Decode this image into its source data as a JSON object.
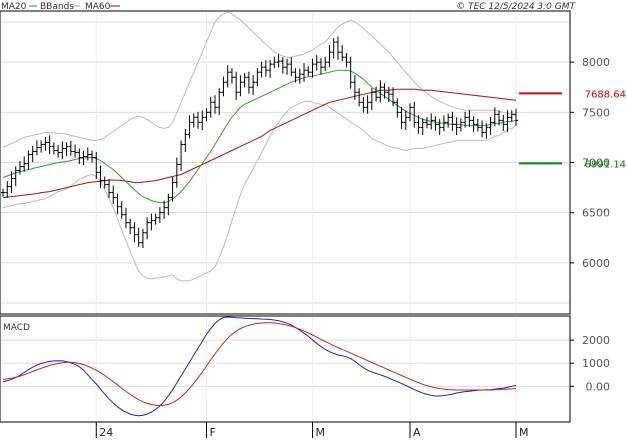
{
  "header": {
    "legend": [
      {
        "name": "MA20",
        "color": "#22aa22"
      },
      {
        "name": "BBands",
        "color": "#aaaaaa"
      },
      {
        "name": "MA60",
        "color": "#aa1111"
      }
    ],
    "copyright": "© TEC 12/5/2024 3:0 GMT"
  },
  "chart_data": [
    {
      "type": "line",
      "title": "",
      "subtype": "ohlc-bars",
      "y_axis_position": "right",
      "ylim": [
        5500,
        8500
      ],
      "yticks": [
        6000,
        6500,
        7000,
        7500,
        8000
      ],
      "ytick_labels": [
        "6000",
        "6500",
        "7000",
        "7500",
        "8000"
      ],
      "grid": true,
      "x_labels": [
        {
          "label": "24",
          "index": 22
        },
        {
          "label": "F",
          "index": 48
        },
        {
          "label": "M",
          "index": 73
        },
        {
          "label": "A",
          "index": 96
        },
        {
          "label": "M",
          "index": 121
        }
      ],
      "levels": [
        {
          "label": "7688.64",
          "value": 7688.64,
          "color": "#dd0000"
        },
        {
          "label": "6991.14",
          "value": 6991.14,
          "color": "#008800"
        }
      ],
      "close": [
        6700,
        6760,
        6840,
        6920,
        6960,
        6990,
        7080,
        7110,
        7150,
        7180,
        7200,
        7160,
        7120,
        7100,
        7140,
        7160,
        7110,
        7100,
        7050,
        7060,
        7080,
        7050,
        6900,
        6820,
        6780,
        6700,
        6650,
        6560,
        6480,
        6400,
        6350,
        6280,
        6200,
        6300,
        6400,
        6420,
        6450,
        6500,
        6550,
        6650,
        6800,
        6980,
        7180,
        7280,
        7400,
        7450,
        7400,
        7450,
        7500,
        7600,
        7550,
        7700,
        7800,
        7900,
        7850,
        7700,
        7800,
        7850,
        7750,
        7800,
        7900,
        7950,
        7920,
        7980,
        8000,
        8010,
        7950,
        7980,
        7900,
        7850,
        7880,
        7920,
        7900,
        7980,
        8000,
        7950,
        8000,
        8100,
        8200,
        8100,
        8050,
        8000,
        7800,
        7700,
        7600,
        7550,
        7600,
        7700,
        7650,
        7750,
        7700,
        7680,
        7600,
        7500,
        7400,
        7450,
        7550,
        7400,
        7350,
        7400,
        7380,
        7420,
        7380,
        7350,
        7400,
        7450,
        7380,
        7350,
        7400,
        7450,
        7420,
        7380,
        7350,
        7300,
        7350,
        7400,
        7480,
        7420,
        7380,
        7450,
        7480,
        7420
      ],
      "ma20": [
        6850,
        6865,
        6880,
        6895,
        6910,
        6920,
        6930,
        6940,
        6950,
        6960,
        6970,
        6980,
        6990,
        7000,
        7005,
        7010,
        7020,
        7030,
        7040,
        7045,
        7050,
        7050,
        7040,
        7020,
        6990,
        6960,
        6930,
        6890,
        6850,
        6810,
        6770,
        6730,
        6690,
        6660,
        6640,
        6620,
        6610,
        6600,
        6600,
        6610,
        6640,
        6670,
        6710,
        6760,
        6810,
        6870,
        6930,
        6990,
        7050,
        7110,
        7180,
        7250,
        7320,
        7390,
        7450,
        7500,
        7550,
        7580,
        7600,
        7620,
        7640,
        7660,
        7680,
        7700,
        7720,
        7740,
        7760,
        7780,
        7800,
        7815,
        7830,
        7845,
        7855,
        7860,
        7870,
        7880,
        7890,
        7900,
        7910,
        7920,
        7920,
        7920,
        7910,
        7890,
        7860,
        7830,
        7790,
        7750,
        7720,
        7690,
        7660,
        7630,
        7600,
        7570,
        7540,
        7510,
        7490,
        7470,
        7450,
        7430,
        7420,
        7410,
        7400,
        7395,
        7390,
        7385,
        7380,
        7380,
        7375,
        7370,
        7370,
        7370,
        7370,
        7370,
        7370,
        7380,
        7390,
        7390,
        7400,
        7410,
        7410,
        7420
      ],
      "ma60": [
        6650,
        6655,
        6660,
        6665,
        6670,
        6675,
        6680,
        6685,
        6690,
        6700,
        6705,
        6710,
        6720,
        6730,
        6740,
        6750,
        6760,
        6770,
        6780,
        6790,
        6800,
        6805,
        6810,
        6815,
        6820,
        6825,
        6825,
        6825,
        6820,
        6815,
        6810,
        6800,
        6800,
        6805,
        6810,
        6815,
        6820,
        6830,
        6840,
        6850,
        6860,
        6870,
        6880,
        6900,
        6920,
        6940,
        6960,
        6980,
        7000,
        7020,
        7040,
        7060,
        7080,
        7100,
        7120,
        7140,
        7160,
        7180,
        7200,
        7220,
        7240,
        7260,
        7290,
        7320,
        7340,
        7360,
        7380,
        7400,
        7420,
        7440,
        7460,
        7480,
        7500,
        7520,
        7540,
        7560,
        7580,
        7600,
        7610,
        7620,
        7630,
        7640,
        7650,
        7660,
        7670,
        7680,
        7690,
        7700,
        7710,
        7720,
        7720,
        7720,
        7725,
        7730,
        7730,
        7730,
        7730,
        7730,
        7725,
        7720,
        7720,
        7720,
        7715,
        7710,
        7705,
        7700,
        7695,
        7690,
        7685,
        7680,
        7675,
        7670,
        7665,
        7660,
        7655,
        7650,
        7645,
        7640,
        7635,
        7630,
        7625,
        7620
      ],
      "bb_upper": [
        7150,
        7170,
        7190,
        7210,
        7230,
        7250,
        7260,
        7270,
        7280,
        7290,
        7300,
        7300,
        7295,
        7290,
        7290,
        7280,
        7270,
        7260,
        7250,
        7240,
        7230,
        7220,
        7220,
        7230,
        7250,
        7280,
        7310,
        7340,
        7370,
        7400,
        7430,
        7450,
        7460,
        7450,
        7430,
        7400,
        7370,
        7350,
        7340,
        7350,
        7400,
        7500,
        7600,
        7700,
        7800,
        7900,
        8000,
        8100,
        8200,
        8300,
        8400,
        8450,
        8480,
        8500,
        8480,
        8450,
        8420,
        8380,
        8340,
        8300,
        8260,
        8220,
        8180,
        8140,
        8100,
        8080,
        8060,
        8050,
        8050,
        8060,
        8070,
        8080,
        8100,
        8120,
        8150,
        8180,
        8200,
        8250,
        8300,
        8350,
        8380,
        8400,
        8420,
        8400,
        8370,
        8340,
        8300,
        8260,
        8220,
        8180,
        8140,
        8100,
        8050,
        8000,
        7950,
        7900,
        7850,
        7800,
        7760,
        7720,
        7690,
        7660,
        7630,
        7610,
        7590,
        7570,
        7555,
        7540,
        7530,
        7520,
        7520,
        7520,
        7520,
        7520,
        7520,
        7520,
        7520,
        7510,
        7500,
        7490,
        7480,
        7470
      ],
      "bb_lower": [
        6550,
        6560,
        6570,
        6580,
        6590,
        6590,
        6600,
        6610,
        6620,
        6630,
        6640,
        6660,
        6685,
        6710,
        6720,
        6740,
        6770,
        6800,
        6830,
        6850,
        6870,
        6880,
        6860,
        6810,
        6730,
        6640,
        6550,
        6440,
        6330,
        6220,
        6110,
        6010,
        5920,
        5870,
        5850,
        5840,
        5850,
        5850,
        5860,
        5870,
        5880,
        5840,
        5820,
        5820,
        5820,
        5840,
        5860,
        5880,
        5900,
        5920,
        5960,
        6050,
        6160,
        6280,
        6420,
        6550,
        6680,
        6780,
        6860,
        6940,
        7020,
        7100,
        7180,
        7260,
        7340,
        7400,
        7460,
        7510,
        7550,
        7570,
        7590,
        7610,
        7610,
        7600,
        7590,
        7580,
        7580,
        7550,
        7520,
        7490,
        7460,
        7440,
        7400,
        7380,
        7350,
        7320,
        7280,
        7240,
        7220,
        7200,
        7180,
        7160,
        7150,
        7140,
        7130,
        7120,
        7130,
        7140,
        7140,
        7140,
        7150,
        7160,
        7170,
        7180,
        7190,
        7200,
        7205,
        7220,
        7220,
        7220,
        7220,
        7220,
        7220,
        7220,
        7220,
        7240,
        7260,
        7270,
        7300,
        7330,
        7340,
        7370
      ]
    },
    {
      "type": "line",
      "title": "MACD",
      "y_axis_position": "right",
      "ylim": [
        -1500,
        3000
      ],
      "yticks": [
        0,
        1000,
        2000
      ],
      "ytick_labels": [
        "0.00",
        "1000",
        "2000"
      ],
      "series": [
        {
          "name": "",
          "color": "#2222cc",
          "values": [
            200,
            240,
            300,
            380,
            480,
            600,
            720,
            830,
            920,
            990,
            1040,
            1080,
            1100,
            1110,
            1100,
            1070,
            1020,
            950,
            850,
            700,
            500,
            300,
            100,
            -120,
            -340,
            -540,
            -720,
            -880,
            -1020,
            -1120,
            -1200,
            -1250,
            -1270,
            -1250,
            -1200,
            -1120,
            -1000,
            -850,
            -650,
            -420,
            -150,
            150,
            450,
            750,
            1050,
            1350,
            1650,
            1950,
            2250,
            2500,
            2720,
            2880,
            2980,
            3000,
            2990,
            2970,
            2960,
            2950,
            2940,
            2930,
            2920,
            2910,
            2900,
            2890,
            2870,
            2840,
            2790,
            2730,
            2650,
            2550,
            2430,
            2300,
            2160,
            2010,
            1860,
            1720,
            1600,
            1500,
            1420,
            1360,
            1320,
            1280,
            1200,
            1080,
            940,
            800,
            700,
            620,
            560,
            500,
            430,
            360,
            280,
            200,
            120,
            40,
            -50,
            -140,
            -220,
            -290,
            -350,
            -390,
            -420,
            -420,
            -400,
            -370,
            -330,
            -290,
            -260,
            -230,
            -210,
            -190,
            -170,
            -160,
            -150,
            -140,
            -120,
            -100,
            -80,
            -40,
            0,
            40
          ]
        },
        {
          "name": "",
          "color": "#cc2222",
          "values": [
            300,
            320,
            350,
            390,
            440,
            500,
            570,
            640,
            710,
            780,
            840,
            900,
            950,
            990,
            1020,
            1040,
            1040,
            1020,
            990,
            940,
            870,
            790,
            700,
            590,
            470,
            340,
            200,
            60,
            -80,
            -220,
            -350,
            -470,
            -580,
            -670,
            -740,
            -790,
            -820,
            -830,
            -820,
            -780,
            -710,
            -600,
            -460,
            -290,
            -90,
            130,
            370,
            620,
            880,
            1140,
            1400,
            1650,
            1880,
            2080,
            2250,
            2390,
            2500,
            2580,
            2640,
            2690,
            2720,
            2740,
            2750,
            2750,
            2740,
            2720,
            2690,
            2650,
            2600,
            2540,
            2470,
            2390,
            2310,
            2220,
            2130,
            2030,
            1940,
            1850,
            1760,
            1680,
            1600,
            1520,
            1440,
            1360,
            1280,
            1200,
            1110,
            1030,
            950,
            870,
            790,
            710,
            630,
            550,
            470,
            390,
            310,
            230,
            160,
            90,
            30,
            -20,
            -60,
            -100,
            -120,
            -140,
            -150,
            -160,
            -160,
            -160,
            -160,
            -160,
            -160,
            -160,
            -160,
            -160,
            -150,
            -140,
            -130,
            -120,
            -110,
            -100
          ]
        }
      ]
    }
  ]
}
